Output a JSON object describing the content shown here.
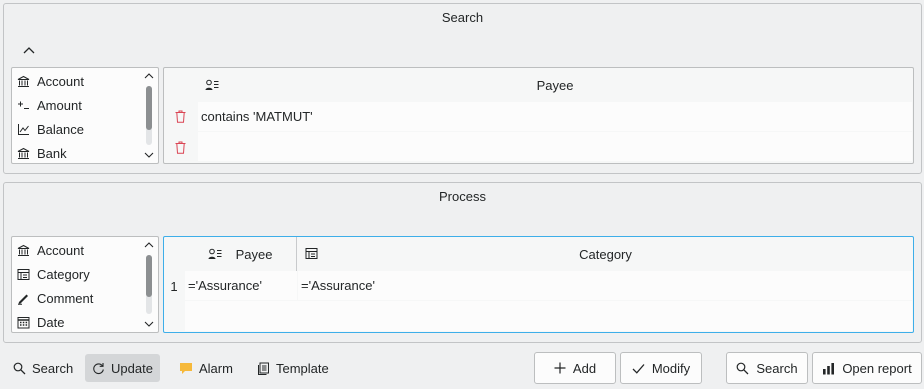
{
  "search": {
    "title": "Search",
    "attributes": [
      {
        "label": "Account",
        "icon": "bank-icon"
      },
      {
        "label": "Amount",
        "icon": "plus-minus-icon"
      },
      {
        "label": "Balance",
        "icon": "chart-icon"
      },
      {
        "label": "Bank",
        "icon": "bank-icon"
      }
    ],
    "table": {
      "column": "Payee",
      "rows": [
        {
          "value": "contains 'MATMUT'"
        },
        {
          "value": ""
        }
      ]
    }
  },
  "process": {
    "title": "Process",
    "attributes": [
      {
        "label": "Account",
        "icon": "bank-icon"
      },
      {
        "label": "Category",
        "icon": "category-icon"
      },
      {
        "label": "Comment",
        "icon": "comment-icon"
      },
      {
        "label": "Date",
        "icon": "calendar-icon"
      }
    ],
    "table": {
      "columns": [
        "Payee",
        "Category"
      ],
      "rows": [
        {
          "num": "1",
          "payee": "='Assurance'",
          "category": "='Assurance'"
        }
      ]
    }
  },
  "toolbar": {
    "search": "Search",
    "update": "Update",
    "alarm": "Alarm",
    "template": "Template"
  },
  "buttons": {
    "add": "Add",
    "modify": "Modify",
    "search": "Search",
    "open_report": "Open report"
  },
  "colors": {
    "accent": "#3daee9",
    "delete": "#da4453",
    "alarm": "#f6b93b"
  }
}
